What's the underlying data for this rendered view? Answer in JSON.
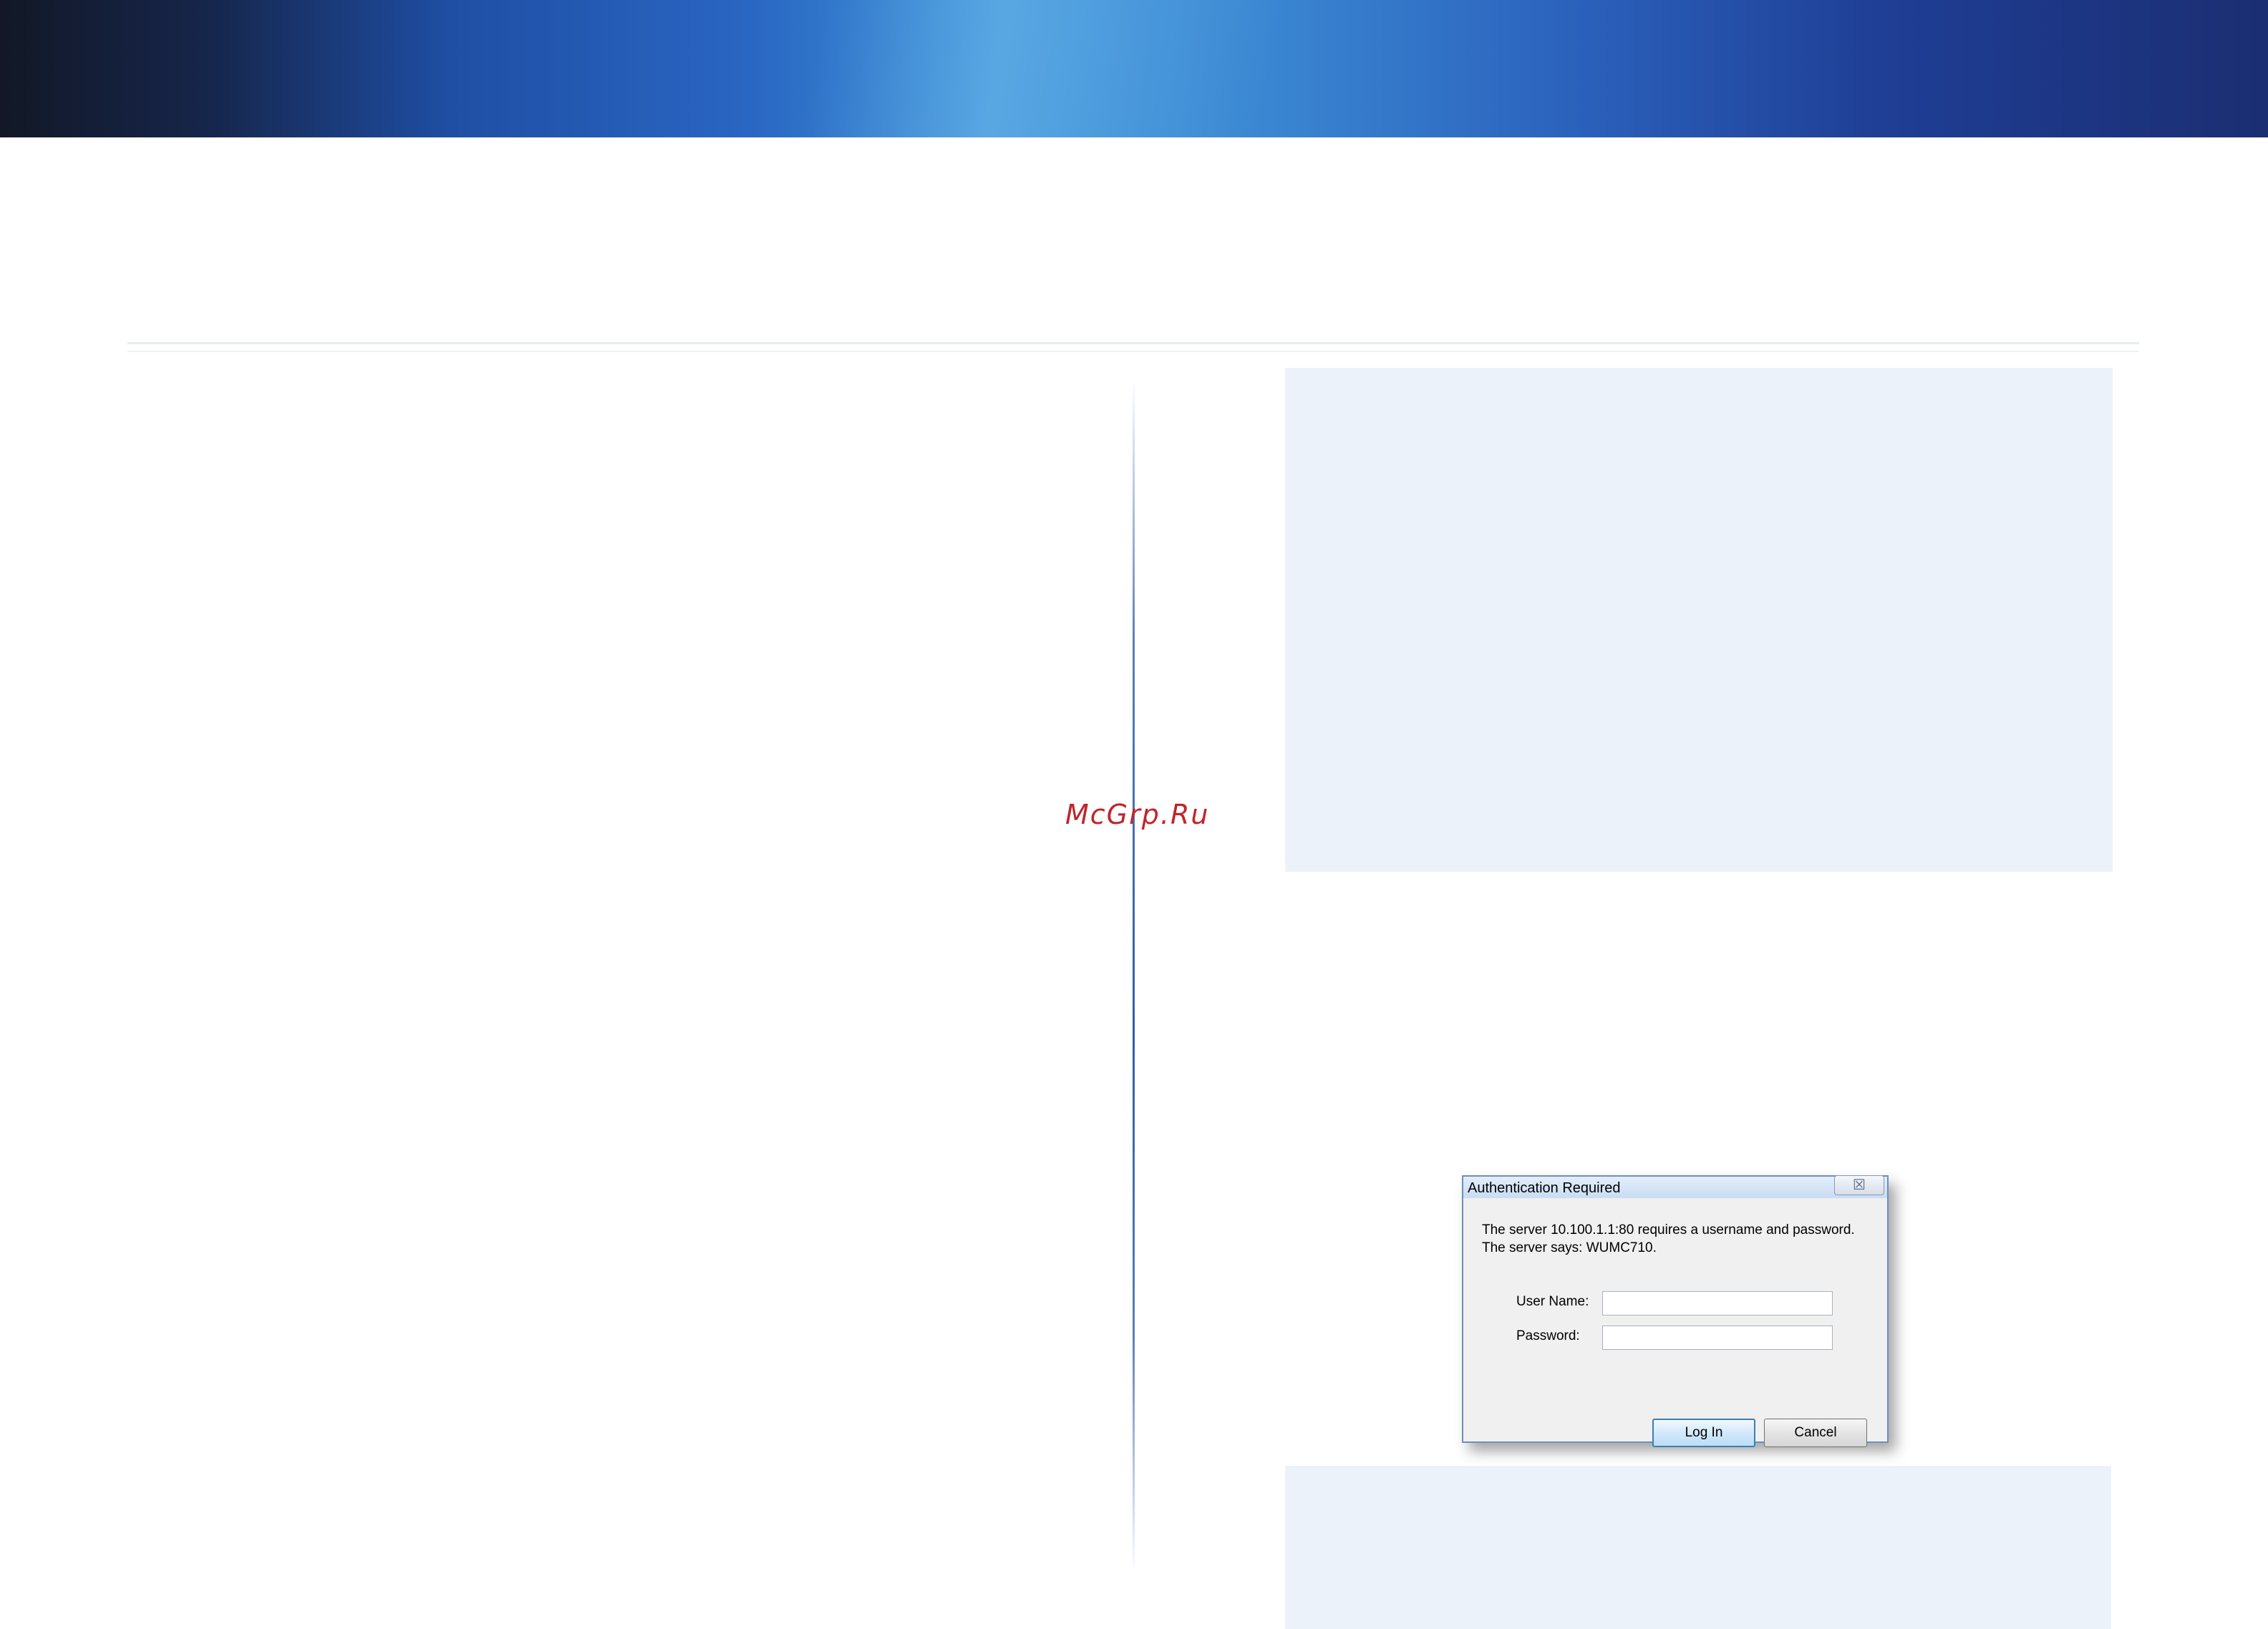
{
  "watermark": "McGrp.Ru",
  "dialog": {
    "title": "Authentication Required",
    "close_glyph": "☒",
    "message": "The server 10.100.1.1:80 requires a username and password.\nThe server says: WUMC710.",
    "username_label": "User Name:",
    "password_label": "Password:",
    "username_value": "",
    "password_value": "",
    "login_label": "Log In",
    "cancel_label": "Cancel"
  },
  "colors": {
    "banner_dark": "#121826",
    "banner_blue": "#3d96d9",
    "note_background": "#ecf2fa",
    "watermark_red": "#c0252c"
  }
}
